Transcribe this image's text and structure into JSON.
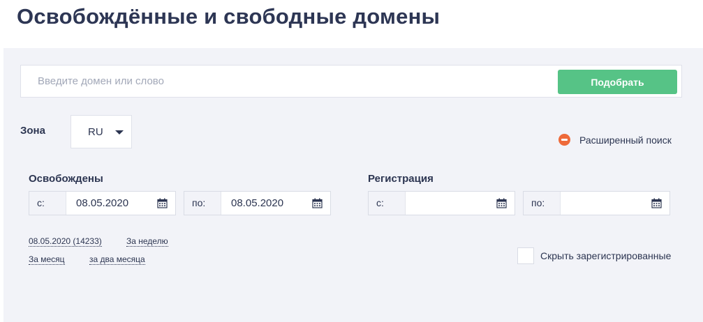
{
  "page": {
    "title": "Освобождённые и свободные домены"
  },
  "search": {
    "placeholder": "Введите домен или слово",
    "value": "",
    "button_label": "Подобрать"
  },
  "zone": {
    "label": "Зона",
    "selected": "RU"
  },
  "advanced_search": {
    "label": "Расширенный поиск",
    "icon": "minus-circle-icon",
    "icon_color": "#ee6a3a"
  },
  "released": {
    "title": "Освобождены",
    "from_prefix": "с:",
    "from_value": "08.05.2020",
    "to_prefix": "по:",
    "to_value": "08.05.2020"
  },
  "registration": {
    "title": "Регистрация",
    "from_prefix": "с:",
    "from_value": "",
    "to_prefix": "по:",
    "to_value": ""
  },
  "quick_links": {
    "today": "08.05.2020 (14233)",
    "week": "За неделю",
    "month": "За месяц",
    "two_months": "за два месяца"
  },
  "hide_registered": {
    "label": "Скрыть зарегистрированные",
    "checked": false
  },
  "colors": {
    "accent_green": "#56c386",
    "text_dark": "#2c3551",
    "panel_bg": "#f2f3f8"
  }
}
